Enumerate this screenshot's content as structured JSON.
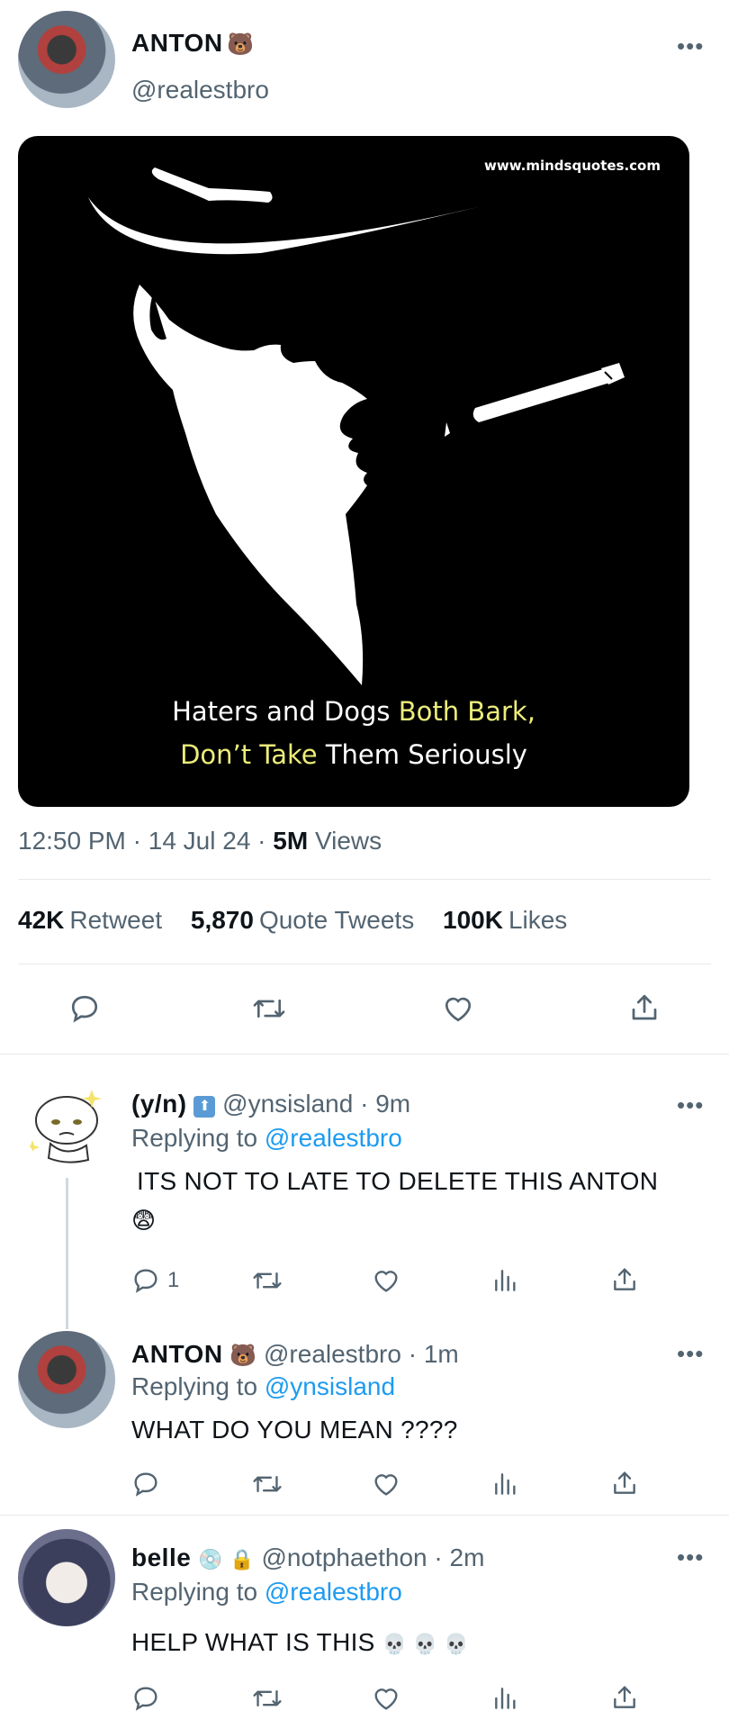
{
  "main_tweet": {
    "author_name": "ANTON",
    "author_emoji": "🐻",
    "handle": "@realestbro",
    "more": "•••",
    "image": {
      "url_text": "www.mindsquotes.com",
      "quote_line1_white": "Haters and Dogs ",
      "quote_line1_yellow": "Both Bark,",
      "quote_line2_yellow": "Don’t Take ",
      "quote_line2_white": "Them Seriously"
    },
    "time": "12:50 PM",
    "date": "14 Jul 24",
    "views_count": "5M",
    "views_label": "Views",
    "retweets_count": "42K",
    "retweets_label": "Retweet",
    "quotes_count": "5,870",
    "quotes_label": "Quote Tweets",
    "likes_count": "100K",
    "likes_label": "Likes"
  },
  "replies": [
    {
      "name": "(y/n)",
      "badge": "⬆",
      "handle": "@ynsisland",
      "time": "9m",
      "replying_prefix": "Replying to",
      "replying_to": "@realestbro",
      "text": "ITS NOT TO LATE TO DELETE THIS ANTON",
      "emoji": "😨",
      "reply_count": "1"
    },
    {
      "name": "ANTON",
      "name_emoji": "🐻",
      "handle": "@realestbro",
      "time": "1m",
      "replying_prefix": "Replying to",
      "replying_to": "@ynsisland",
      "text": "WHAT DO YOU MEAN ????"
    },
    {
      "name": "belle",
      "name_emoji": "💿",
      "lock_emoji": "🔒",
      "handle": "@notphaethon",
      "time": "2m",
      "replying_prefix": "Replying to",
      "replying_to": "@realestbro",
      "text": "HELP WHAT IS THIS",
      "trailing_emoji": "💀 💀 💀"
    }
  ],
  "colors": {
    "accent": "#1d9bf0",
    "text": "#0f1419",
    "secondary": "#536471",
    "quote_yellow": "#ecec7a"
  }
}
